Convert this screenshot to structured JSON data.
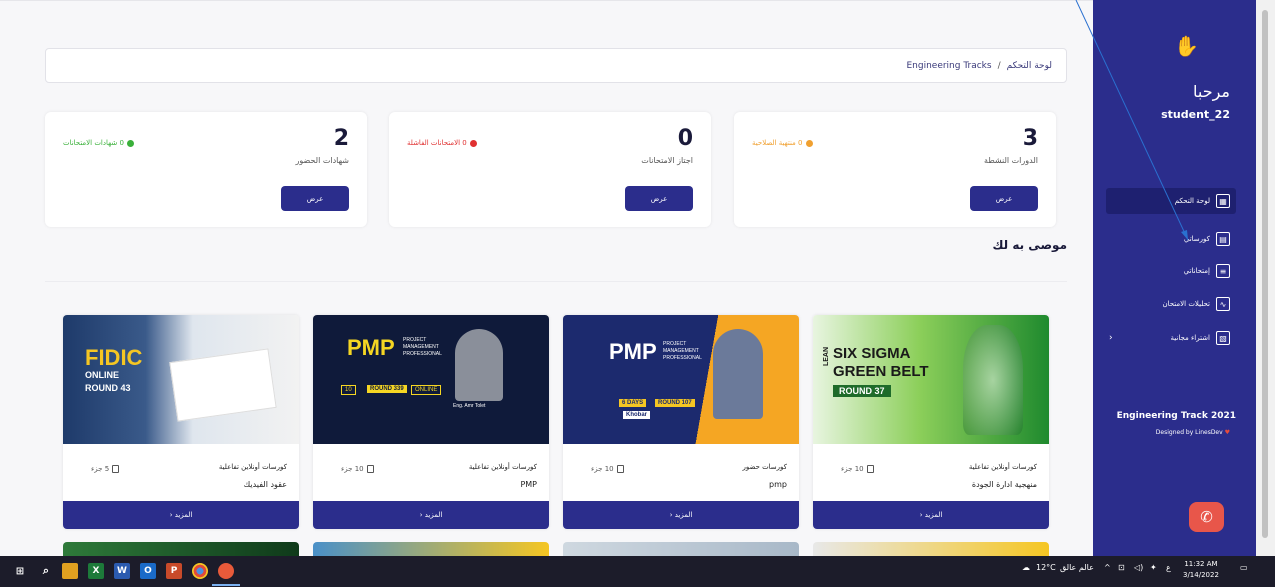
{
  "breadcrumb": {
    "root": "Engineering Tracks",
    "sep": "/",
    "current": "لوحة التحكم"
  },
  "stats": [
    {
      "number": "3",
      "label": "الدورات النشطة",
      "status": "0 منتهية الصلاحية",
      "status_color": "#f0a030",
      "button": "عرض"
    },
    {
      "number": "0",
      "label": "اجتاز الامتحانات",
      "status": "0 الامتحانات الفاشلة",
      "status_color": "#e03030",
      "button": "عرض"
    },
    {
      "number": "2",
      "label": "شهادات الحضور",
      "status": "0 شهادات الامتحانات",
      "status_color": "#3ab03a",
      "button": "عرض"
    }
  ],
  "recommended_title": "موصى به لك",
  "courses": [
    {
      "type": "كورسات أونلاين تفاعلية",
      "name": "منهجية ادارة الجودة",
      "parts": "10 جزء",
      "more": "المزيد ‹",
      "image_text": [
        "SIX SIGMA",
        "GREEN BELT",
        "ROUND 37",
        "LEAN"
      ]
    },
    {
      "type": "كورسات حضور",
      "name": "pmp",
      "parts": "10 جزء",
      "more": "المزيد ‹",
      "image_text": [
        "PMP",
        "PROJECT MANAGEMENT PROFESSIONAL",
        "6 DAYS",
        "ROUND 107",
        "Khobar"
      ]
    },
    {
      "type": "كورسات أونلاين تفاعلية",
      "name": "PMP",
      "parts": "10 جزء",
      "more": "المزيد ‹",
      "image_text": [
        "PMP",
        "PROJECT MANAGEMENT PROFESSIONAL",
        "10",
        "ROUND 339",
        "ONLINE",
        "Eng. Amr Tolet"
      ]
    },
    {
      "type": "كورسات أونلاين تفاعلية",
      "name": "عقود الفيديك",
      "parts": "5 جزء",
      "more": "المزيد ‹",
      "image_text": [
        "FIDIC",
        "ONLINE",
        "ROUND 43"
      ]
    }
  ],
  "sidebar": {
    "greeting": "مرحبا",
    "username": "student_22",
    "items": [
      {
        "label": "لوحة التحكم",
        "icon": "grid-icon"
      },
      {
        "label": "كورساتي",
        "icon": "courses-icon"
      },
      {
        "label": "إمتحاناتي",
        "icon": "exam-icon"
      },
      {
        "label": "تحليلات الامتحان",
        "icon": "chart-icon"
      },
      {
        "label": "اشتراء مجانية",
        "icon": "gift-icon"
      }
    ],
    "collapse_chevron": "‹",
    "brand": "Engineering Track 2021",
    "designed_by": "Designed by LinesDev"
  },
  "taskbar": {
    "weather": "12°C",
    "weather_text": "عالم عالق",
    "lang": "ع",
    "time": "11:32 AM",
    "date": "3/14/2022"
  },
  "colors": {
    "primary": "#2b2d8c",
    "sidebar_dark": "#1e2070",
    "phone": "#e8564a"
  }
}
